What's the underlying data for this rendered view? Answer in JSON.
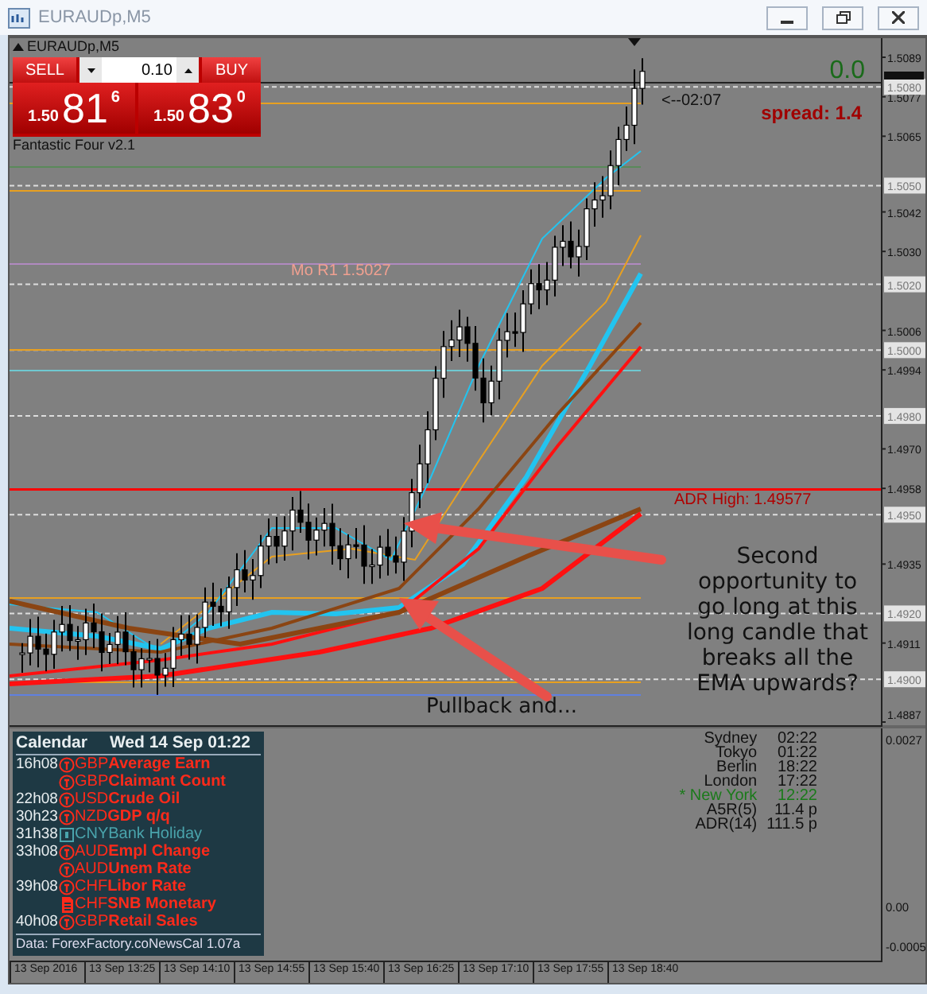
{
  "window": {
    "title": "EURAUDp,M5"
  },
  "chart": {
    "symbol": "EURAUDp,M5",
    "indicator_name": "Fantastic Four v2.1",
    "trade_panel": {
      "sell_label": "SELL",
      "buy_label": "BUY",
      "lot": "0.10",
      "sell_price": {
        "prefix": "1.50",
        "main": "81",
        "fraction": "6"
      },
      "buy_price": {
        "prefix": "1.50",
        "main": "83",
        "fraction": "0"
      }
    },
    "countdown": "<--02:07",
    "profit": "0.0",
    "spread": "spread: 1.4",
    "levels": [
      {
        "label": "Mo R1  1.5027",
        "kind": "pivot"
      },
      {
        "label": "ADR High: 1.49577",
        "kind": "adr"
      }
    ],
    "price_axis": {
      "ticks": [
        "1.5089",
        "1.5077",
        "1.5065",
        "1.5042",
        "1.5030",
        "1.5006",
        "1.4994",
        "1.4970",
        "1.4958",
        "1.4935",
        "1.4911",
        "1.4887"
      ],
      "marked_levels": [
        "1.5080",
        "1.5050",
        "1.5020",
        "1.5000",
        "1.4980",
        "1.4950",
        "1.4920",
        "1.4900"
      ]
    },
    "annotations": [
      {
        "kind": "callout",
        "text": "Second opportunity to go long at this long candle that breaks all the EMA upwards?"
      },
      {
        "kind": "caption",
        "text": "Pullback and..."
      }
    ],
    "time_axis": [
      "13 Sep 2016",
      "13 Sep 13:25",
      "13 Sep 14:10",
      "13 Sep 14:55",
      "13 Sep 15:40",
      "13 Sep 16:25",
      "13 Sep 17:10",
      "13 Sep 17:55",
      "13 Sep 18:40"
    ]
  },
  "calendar": {
    "title": "Calendar",
    "date": "Wed 14 Sep 01:22",
    "events": [
      {
        "time": "16h08",
        "kind": "high",
        "currency": "GBP",
        "title": "Average Earn"
      },
      {
        "kind": "high",
        "currency": "GBP",
        "title": "Claimant Count"
      },
      {
        "time": "22h08",
        "kind": "high",
        "currency": "USD",
        "title": "Crude Oil"
      },
      {
        "time": "30h23",
        "kind": "high",
        "currency": "NZD",
        "title": "GDP q/q"
      },
      {
        "time": "31h38",
        "kind": "holiday",
        "currency": "CNY",
        "title": "Bank Holiday"
      },
      {
        "time": "33h08",
        "kind": "high",
        "currency": "AUD",
        "title": "Empl Change"
      },
      {
        "kind": "high",
        "currency": "AUD",
        "title": "Unem Rate"
      },
      {
        "time": "39h08",
        "kind": "high",
        "currency": "CHF",
        "title": "Libor Rate"
      },
      {
        "kind": "report",
        "currency": "CHF",
        "title": "SNB Monetary"
      },
      {
        "time": "40h08",
        "kind": "high",
        "currency": "GBP",
        "title": "Retail Sales"
      }
    ],
    "source": "Data: ForexFactory.co",
    "version": "NewsCal 1.07a"
  },
  "sessions": [
    {
      "name": "Sydney",
      "value": "02:22",
      "active": false
    },
    {
      "name": "Tokyo",
      "value": "01:22",
      "active": false
    },
    {
      "name": "Berlin",
      "value": "18:22",
      "active": false
    },
    {
      "name": "London",
      "value": "17:22",
      "active": false
    },
    {
      "name": "* New York",
      "value": "12:22",
      "active": true
    },
    {
      "name": "A5R(5)",
      "value": "11.4 p",
      "active": false
    },
    {
      "name": "ADR(14)",
      "value": "111.5 p",
      "active": false
    }
  ],
  "indicator_axis": [
    "0.0027",
    "0.00",
    "-0.0005"
  ]
}
